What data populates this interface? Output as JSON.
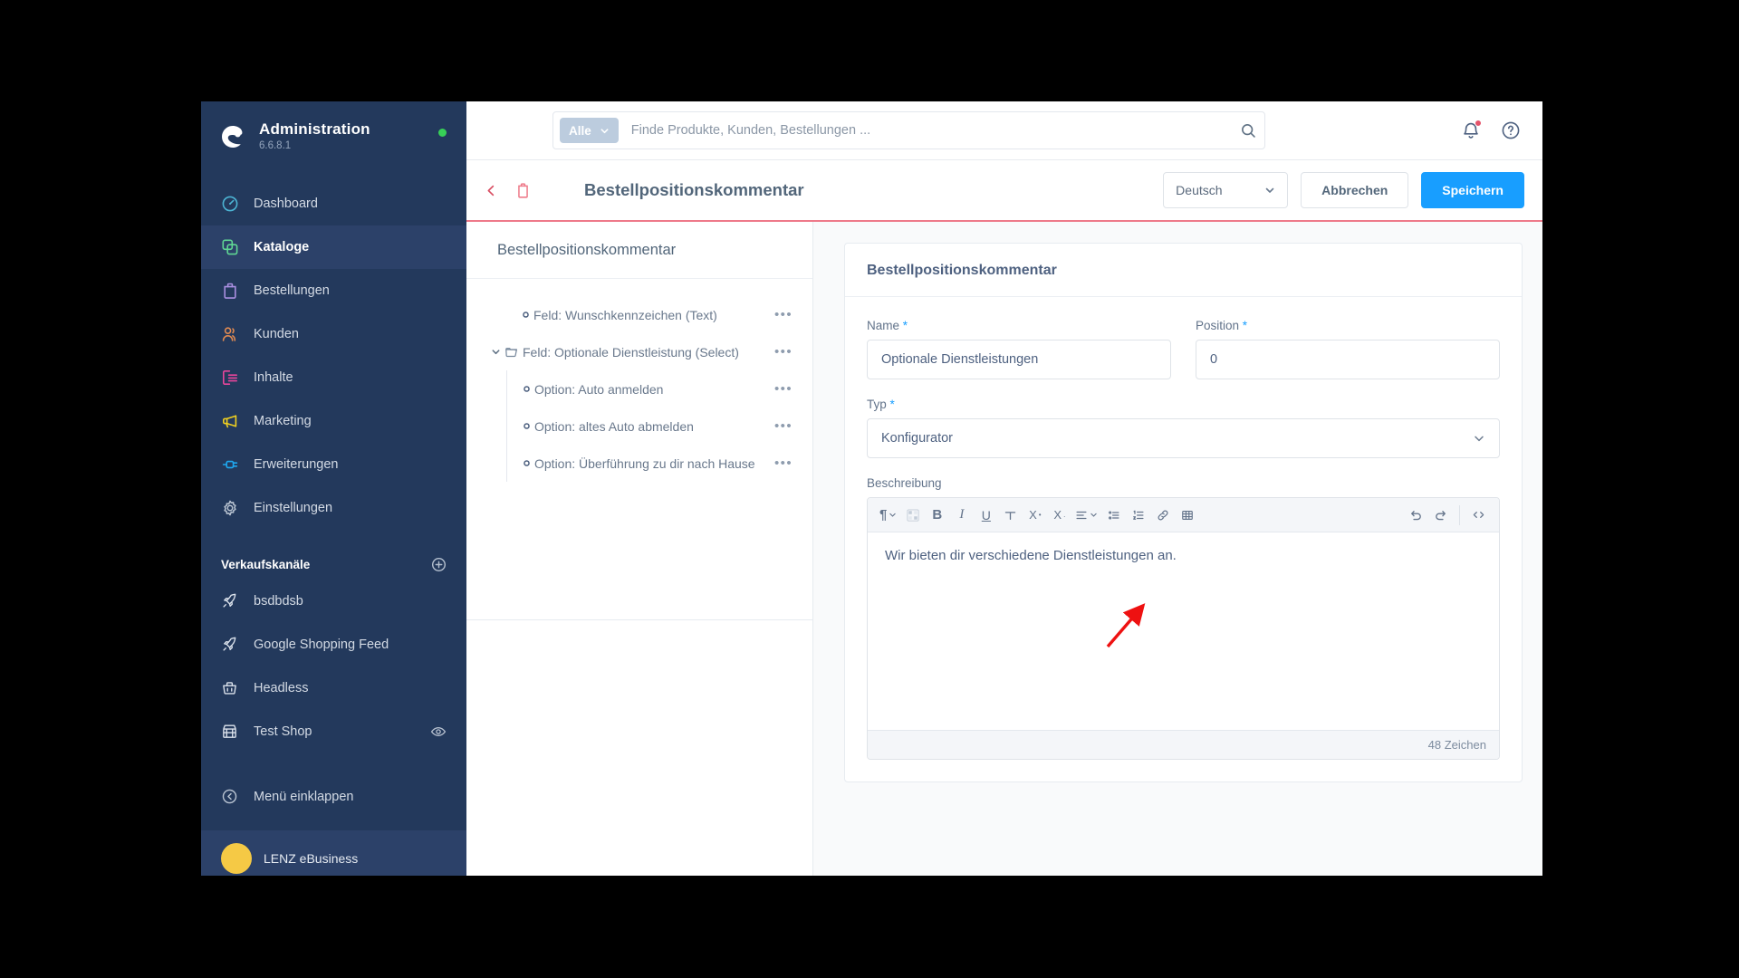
{
  "sidebar": {
    "brand": {
      "title": "Administration",
      "version": "6.6.8.1",
      "status_color": "#37d057"
    },
    "nav": [
      {
        "label": "Dashboard",
        "icon": "dashboard-icon",
        "color": "#4cb4d4",
        "active": false
      },
      {
        "label": "Kataloge",
        "icon": "catalog-icon",
        "color": "#5fd694",
        "active": true
      },
      {
        "label": "Bestellungen",
        "icon": "orders-icon",
        "color": "#a98fe0",
        "active": false
      },
      {
        "label": "Kunden",
        "icon": "customers-icon",
        "color": "#e08a52",
        "active": false
      },
      {
        "label": "Inhalte",
        "icon": "content-icon",
        "color": "#e8459b",
        "active": false
      },
      {
        "label": "Marketing",
        "icon": "marketing-icon",
        "color": "#f0d020",
        "active": false
      },
      {
        "label": "Erweiterungen",
        "icon": "extensions-icon",
        "color": "#1fa8f0",
        "active": false
      },
      {
        "label": "Einstellungen",
        "icon": "settings-icon",
        "color": "#b9c4d2",
        "active": false
      }
    ],
    "sales_channels_header": "Verkaufskanäle",
    "sales_channels": [
      {
        "label": "bsdbdsb",
        "icon": "rocket-icon",
        "has_eye": false
      },
      {
        "label": "Google Shopping Feed",
        "icon": "rocket-icon",
        "has_eye": false
      },
      {
        "label": "Headless",
        "icon": "basket-icon",
        "has_eye": false
      },
      {
        "label": "Test Shop",
        "icon": "storefront-icon",
        "has_eye": true
      }
    ],
    "collapse_label": "Menü einklappen",
    "user_name": "LENZ eBusiness"
  },
  "topbar": {
    "scope_label": "Alle",
    "search_placeholder": "Finde Produkte, Kunden, Bestellungen ...",
    "search_value": "",
    "icons": [
      "search-icon",
      "bell-icon",
      "help-icon"
    ]
  },
  "pageheader": {
    "title": "Bestellpositionskommentar",
    "language": "Deutsch",
    "cancel_label": "Abbrechen",
    "save_label": "Speichern",
    "accent_color": "#ee7a8a",
    "primary_color": "#189eff"
  },
  "tree": {
    "header": "Bestellpositionskommentar",
    "items": [
      {
        "label": "Feld: Wunschkennzeichen (Text)",
        "type": "leaf",
        "level": 0
      },
      {
        "label": "Feld: Optionale Dienstleistung (Select)",
        "type": "folder",
        "level": 0,
        "expanded": true
      },
      {
        "label": "Option: Auto anmelden",
        "type": "leaf",
        "level": 1
      },
      {
        "label": "Option: altes Auto abmelden",
        "type": "leaf",
        "level": 1
      },
      {
        "label": "Option: Überführung zu dir nach Hause",
        "type": "leaf",
        "level": 1
      }
    ],
    "menu_glyph": "•••"
  },
  "form": {
    "card_title": "Bestellpositionskommentar",
    "name_label": "Name",
    "name_value": "Optionale Dienstleistungen",
    "position_label": "Position",
    "position_value": "0",
    "type_label": "Typ",
    "type_value": "Konfigurator",
    "description_label": "Beschreibung",
    "description_text": "Wir bieten dir verschiedene Dienstleistungen an.",
    "char_count": "48 Zeichen",
    "required_marker": "*",
    "toolbar": [
      {
        "name": "paragraph-style-dropdown",
        "glyph": "¶"
      },
      {
        "name": "text-color-icon",
        "glyph": "▦"
      },
      {
        "name": "bold-icon",
        "glyph": "B"
      },
      {
        "name": "italic-icon",
        "glyph": "I"
      },
      {
        "name": "underline-icon",
        "glyph": "U"
      },
      {
        "name": "strikethrough-icon",
        "glyph": "T"
      },
      {
        "name": "superscript-icon",
        "glyph": "X"
      },
      {
        "name": "subscript-icon",
        "glyph": "X"
      },
      {
        "name": "align-dropdown-icon",
        "glyph": "≡"
      },
      {
        "name": "bullet-list-icon",
        "glyph": "•≡"
      },
      {
        "name": "numbered-list-icon",
        "glyph": "1≡"
      },
      {
        "name": "link-icon",
        "glyph": "🔗"
      },
      {
        "name": "table-icon",
        "glyph": "▦"
      }
    ],
    "toolbar_right": [
      {
        "name": "undo-icon",
        "glyph": "↺"
      },
      {
        "name": "redo-icon",
        "glyph": "↻"
      },
      {
        "name": "source-code-icon",
        "glyph": "<>"
      }
    ]
  }
}
